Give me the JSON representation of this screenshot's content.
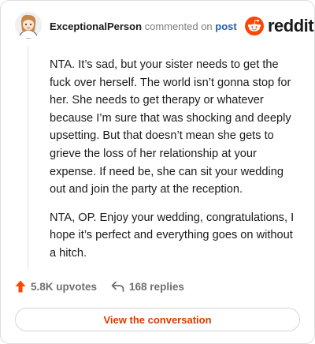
{
  "header": {
    "username": "ExceptionalPerson",
    "action_text": "commented on",
    "target_text": "post",
    "brand_name": "reddit",
    "brand_color": "#ff4500"
  },
  "comment": {
    "paragraphs": [
      "NTA. It’s sad, but your sister needs to get the fuck over herself. The world isn’t gonna stop for her. She needs to get therapy or whatever because I’m sure that was shocking and deeply upsetting. But that doesn’t mean she gets to grieve the loss of her relationship at your expense. If need be, she can sit your wedding out and join the party at the reception.",
      "NTA, OP. Enjoy your wedding, congratulations, I hope it’s perfect and everything goes on without a hitch."
    ]
  },
  "stats": {
    "upvotes": "5.8K upvotes",
    "replies": "168 replies",
    "upvote_icon": "upvote-arrow-icon",
    "reply_icon": "reply-arrow-icon",
    "upvote_color": "#ff4500"
  },
  "footer": {
    "button_label": "View the conversation",
    "button_color": "#d93a00"
  }
}
